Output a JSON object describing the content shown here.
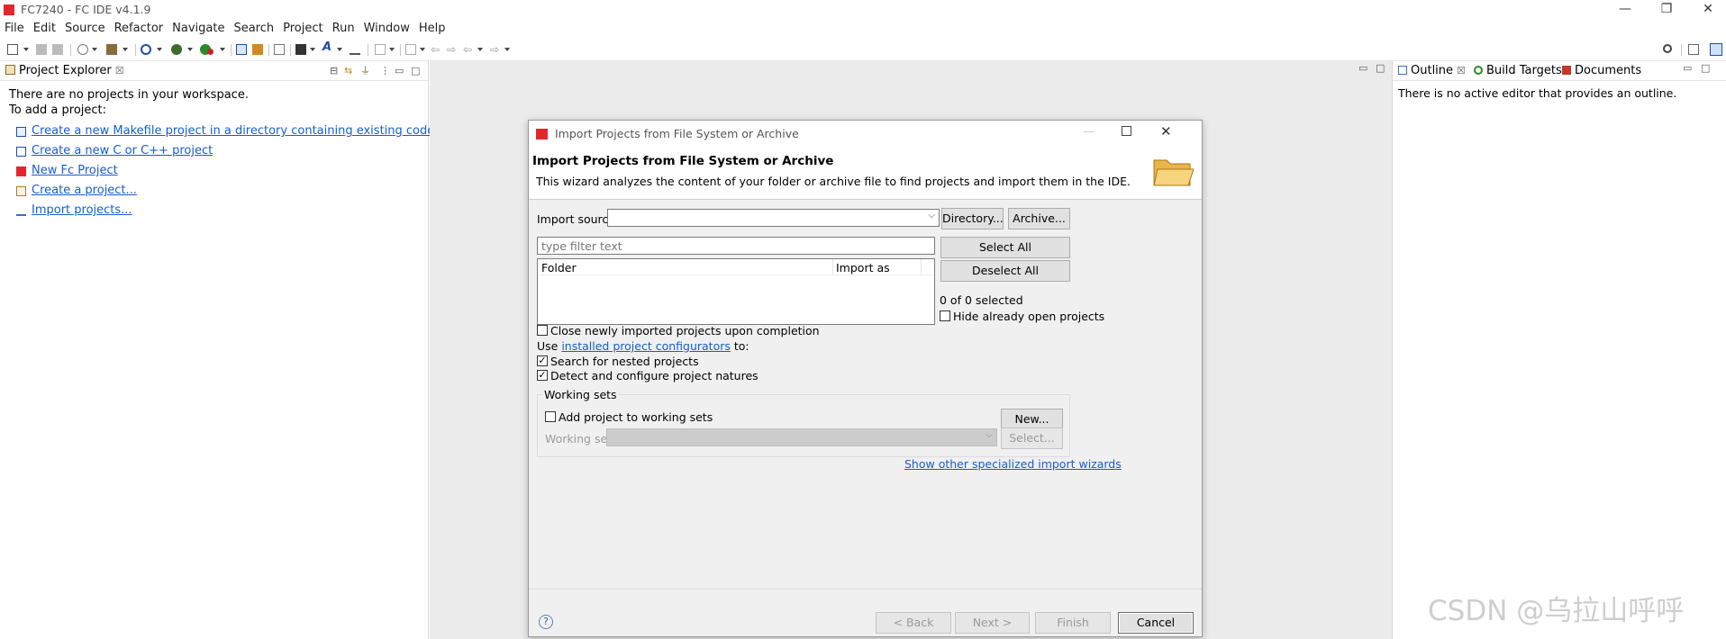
{
  "window": {
    "title": "FC7240 - FC IDE v4.1.9",
    "minimize": "—",
    "restore": "❐",
    "close": "✕"
  },
  "menubar": [
    "File",
    "Edit",
    "Source",
    "Refactor",
    "Navigate",
    "Search",
    "Project",
    "Run",
    "Window",
    "Help"
  ],
  "colors": {
    "brand": "#e3262d",
    "link": "#1a5ccc",
    "editor_bg": "#ebebeb",
    "dialog_bg": "#f0f0f0"
  },
  "project_explorer": {
    "tab_label": "Project Explorer",
    "close_glyph": "☒",
    "message_line1": "There are no projects in your workspace.",
    "message_line2": "To add a project:",
    "links": [
      {
        "label": "Create a new Makefile project in a directory containing existing code",
        "icon": "makefile-project-icon"
      },
      {
        "label": "Create a new C or C++ project",
        "icon": "c-project-icon"
      },
      {
        "label": "New Fc Project",
        "icon": "fc-project-icon"
      },
      {
        "label": "Create a project...",
        "icon": "new-project-icon"
      },
      {
        "label": "Import projects...",
        "icon": "import-icon"
      }
    ]
  },
  "right_panel": {
    "tabs": [
      {
        "label": "Outline",
        "icon": "outline-icon"
      },
      {
        "label": "Build Targets",
        "icon": "build-targets-icon"
      },
      {
        "label": "Documents",
        "icon": "documents-icon"
      }
    ],
    "close_glyph": "☒",
    "message": "There is no active editor that provides an outline."
  },
  "dialog": {
    "window_title": "Import Projects from File System or Archive",
    "heading": "Import Projects from File System or Archive",
    "description": "This wizard analyzes the content of your folder or archive file to find projects and import them in the IDE.",
    "import_source_label": "Import source:",
    "import_source_value": "",
    "directory_button": "Directory...",
    "archive_button": "Archive...",
    "filter_placeholder": "type filter text",
    "select_all_button": "Select All",
    "deselect_all_button": "Deselect All",
    "table_headers": [
      "Folder",
      "Import as"
    ],
    "selected_count": "0 of 0 selected",
    "hide_open_label": "Hide already open projects",
    "hide_open_checked": false,
    "close_imported_label": "Close newly imported projects upon completion",
    "close_imported_checked": false,
    "use_prefix": "Use ",
    "configurators_link": "installed project configurators",
    "use_suffix": " to:",
    "search_nested_label": "Search for nested projects",
    "search_nested_checked": true,
    "detect_natures_label": "Detect and configure project natures",
    "detect_natures_checked": true,
    "working_sets_group": "Working sets",
    "add_to_working_sets_label": "Add project to working sets",
    "add_to_working_sets_checked": false,
    "new_button": "New...",
    "working_sets_label": "Working sets:",
    "working_sets_value": "",
    "select_button": "Select...",
    "show_wizards_link": "Show other specialized import wizards",
    "help_glyph": "?",
    "back_button": "< Back",
    "next_button": "Next >",
    "finish_button": "Finish",
    "cancel_button": "Cancel"
  },
  "watermark": "CSDN @乌拉山呼呼"
}
